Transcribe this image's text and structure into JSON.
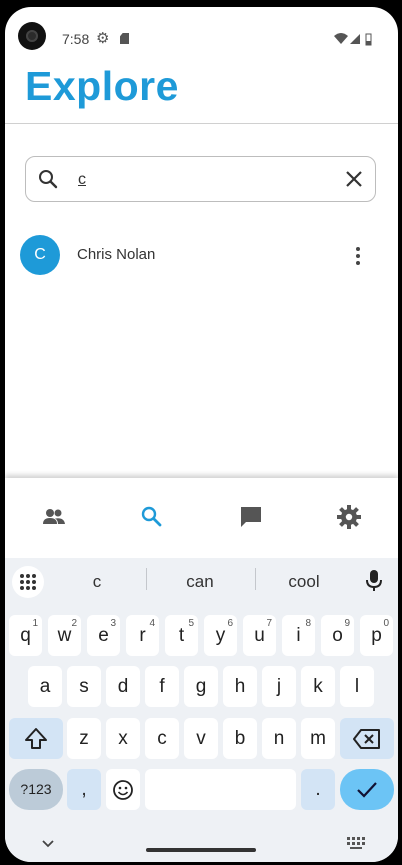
{
  "status_bar": {
    "time": "7:58",
    "gear_icon": "gear-icon",
    "sd_icon": "sd-card-icon",
    "wifi_icon": "wifi-icon",
    "signal_icon": "signal-icon",
    "battery_icon": "battery-icon"
  },
  "header": {
    "title": "Explore"
  },
  "search": {
    "value": "c",
    "placeholder": ""
  },
  "results": [
    {
      "initial": "C",
      "name": "Chris Nolan"
    }
  ],
  "bottom_nav": {
    "items": [
      "people-icon",
      "search-icon",
      "chat-icon",
      "settings-icon"
    ],
    "active_index": 1
  },
  "keyboard": {
    "suggestions": [
      "c",
      "can",
      "cool"
    ],
    "row1": [
      {
        "letter": "q",
        "num": "1"
      },
      {
        "letter": "w",
        "num": "2"
      },
      {
        "letter": "e",
        "num": "3"
      },
      {
        "letter": "r",
        "num": "4"
      },
      {
        "letter": "t",
        "num": "5"
      },
      {
        "letter": "y",
        "num": "6"
      },
      {
        "letter": "u",
        "num": "7"
      },
      {
        "letter": "i",
        "num": "8"
      },
      {
        "letter": "o",
        "num": "9"
      },
      {
        "letter": "p",
        "num": "0"
      }
    ],
    "row2": [
      "a",
      "s",
      "d",
      "f",
      "g",
      "h",
      "j",
      "k",
      "l"
    ],
    "row3": [
      "z",
      "x",
      "c",
      "v",
      "b",
      "n",
      "m"
    ],
    "sym_label": "?123",
    "comma": ",",
    "period": "."
  },
  "colors": {
    "accent": "#1e9ad8",
    "keyboard_bg": "#eef1f5",
    "enter_key": "#6cc4f5"
  }
}
